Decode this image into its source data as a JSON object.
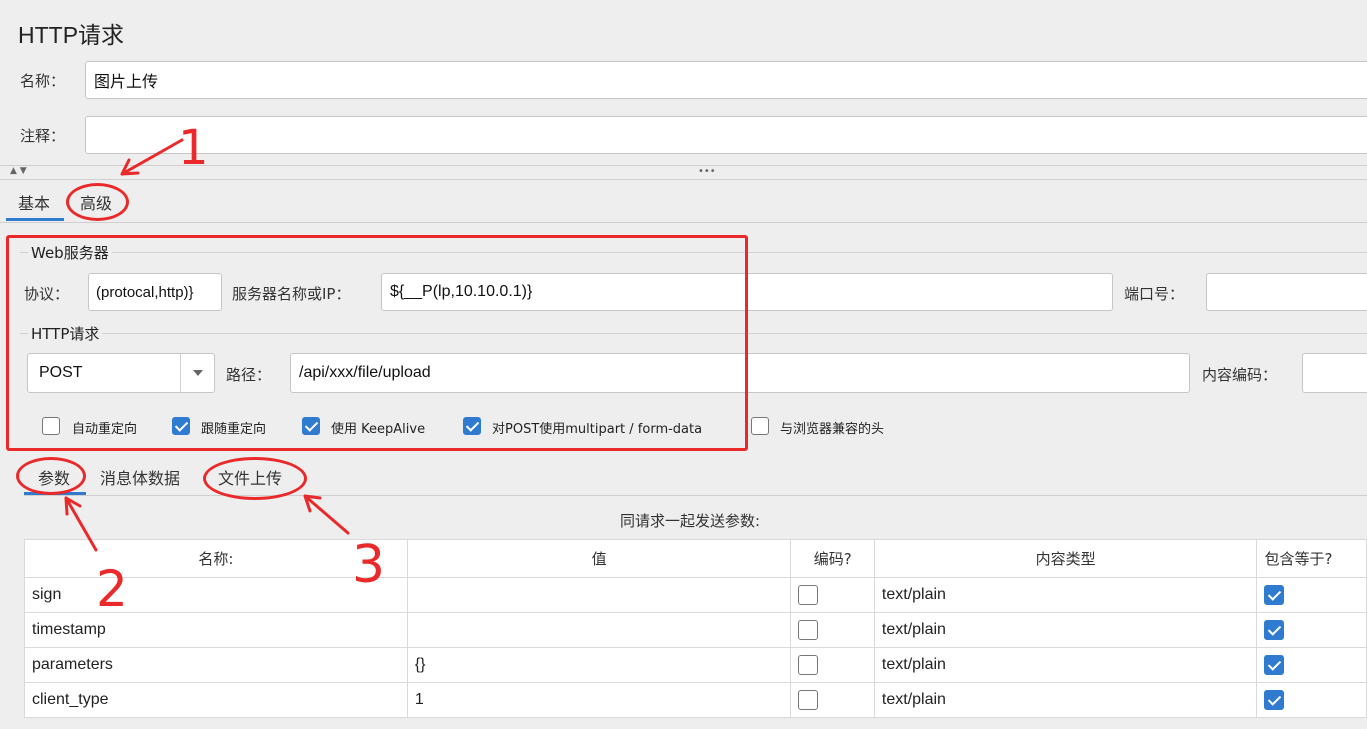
{
  "panel_title": "HTTP请求",
  "name": {
    "label": "名称：",
    "value": "图片上传"
  },
  "comment": {
    "label": "注释：",
    "value": ""
  },
  "splitter": {
    "arrows": "▲ ▼",
    "dots": "•••"
  },
  "main_tabs": [
    {
      "label": "基本",
      "selected": true
    },
    {
      "label": "高级",
      "selected": false
    }
  ],
  "web_server": {
    "group_title": "Web服务器",
    "protocol_label": "协议：",
    "protocol_value": "(protocal,http)}",
    "server_label": "服务器名称或IP：",
    "server_value": "${__P(lp,10.10.0.1)}",
    "port_label": "端口号：",
    "port_value": ""
  },
  "http_request": {
    "group_title": "HTTP请求",
    "method": "POST",
    "path_label": "路径：",
    "path_value": "/api/xxx/file/upload",
    "encoding_label": "内容编码：",
    "encoding_value": ""
  },
  "options": [
    {
      "label": "自动重定向",
      "checked": false
    },
    {
      "label": "跟随重定向",
      "checked": true
    },
    {
      "label": "使用 KeepAlive",
      "checked": true
    },
    {
      "label": "对POST使用multipart / form-data",
      "checked": true
    },
    {
      "label": "与浏览器兼容的头",
      "checked": false
    }
  ],
  "sub_tabs": [
    {
      "label": "参数",
      "selected": true
    },
    {
      "label": "消息体数据",
      "selected": false
    },
    {
      "label": "文件上传",
      "selected": false
    }
  ],
  "params_caption": "同请求一起发送参数:",
  "params_table": {
    "columns": [
      "名称:",
      "值",
      "编码?",
      "内容类型",
      "包含等于?"
    ],
    "rows": [
      {
        "name": "sign",
        "value": "",
        "encode": false,
        "content_type": "text/plain",
        "include_equals": true
      },
      {
        "name": "timestamp",
        "value": "",
        "encode": false,
        "content_type": "text/plain",
        "include_equals": true
      },
      {
        "name": "parameters",
        "value": "{}",
        "encode": false,
        "content_type": "text/plain",
        "include_equals": true
      },
      {
        "name": "client_type",
        "value": "1",
        "encode": false,
        "content_type": "text/plain",
        "include_equals": true
      }
    ]
  },
  "annotations": {
    "color": "#ea2a2a",
    "marks": [
      "1",
      "2",
      "3"
    ]
  },
  "colors": {
    "accent": "#2e7bcf",
    "annotation": "#ea2a2a",
    "background": "#eeeeee"
  }
}
